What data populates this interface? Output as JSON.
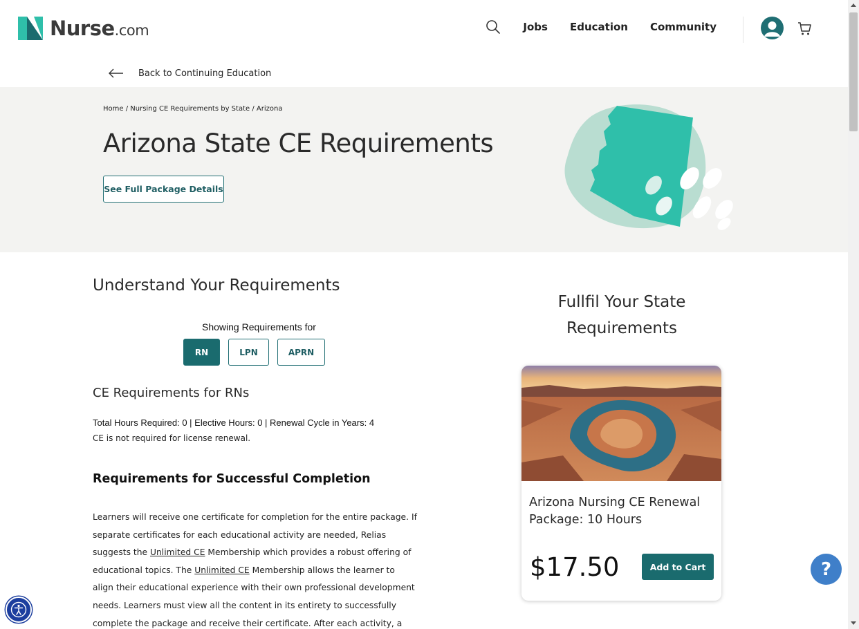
{
  "header": {
    "logo_main": "Nurse",
    "logo_suffix": ".com",
    "nav": [
      {
        "label": "Jobs"
      },
      {
        "label": "Education"
      },
      {
        "label": "Community"
      }
    ]
  },
  "back_link": "Back to Continuing Education",
  "breadcrumb": {
    "home": "Home",
    "sep1": " / ",
    "state_requirements": "Nursing CE Requirements by State",
    "sep2": " / ",
    "current": "Arizona"
  },
  "hero": {
    "title": "Arizona State CE Requirements",
    "package_button": "See Full Package Details"
  },
  "requirements": {
    "heading": "Understand Your Requirements",
    "showing_label": "Showing Requirements for",
    "tabs": [
      {
        "label": "RN",
        "active": true
      },
      {
        "label": "LPN",
        "active": false
      },
      {
        "label": "APRN",
        "active": false
      }
    ],
    "section_heading": "CE Requirements for RNs",
    "hours_line": "Total Hours Required: 0 | Elective Hours: 0 | Renewal Cycle in Years: 4",
    "not_required": "CE is not required for license renewal.",
    "completion_heading": "Requirements for Successful Completion",
    "completion": {
      "p1": "Learners will receive one certificate for completion for the entire package. If separate certificates for each educational activity are needed, Relias suggests the ",
      "link1": "Unlimited CE",
      "p2": " Membership which provides a robust offering of educational topics. The ",
      "link2": "Unlimited CE",
      "p3": " Membership allows the learner to align their educational experience with their own professional development needs. Learners must view all the content in its entirety to successfully complete the package and receive their certificate. After each activity, a question will ask"
    }
  },
  "fulfil": {
    "heading_line1": "Fullfil Your State",
    "heading_line2": "Requirements",
    "card": {
      "title": "Arizona Nursing CE Renewal Package: 10 Hours",
      "price": "$17.50",
      "add_button": "Add to Cart"
    }
  },
  "floating": {
    "help": "?"
  },
  "colors": {
    "brand_teal": "#1a6b6e",
    "accent_mint": "#2fbfaa",
    "help_blue": "#3f7fc9",
    "a11y_blue": "#1c3e9e"
  },
  "icons": [
    "search-icon",
    "user-avatar-icon",
    "cart-icon",
    "back-arrow-icon",
    "help-icon",
    "accessibility-icon"
  ]
}
